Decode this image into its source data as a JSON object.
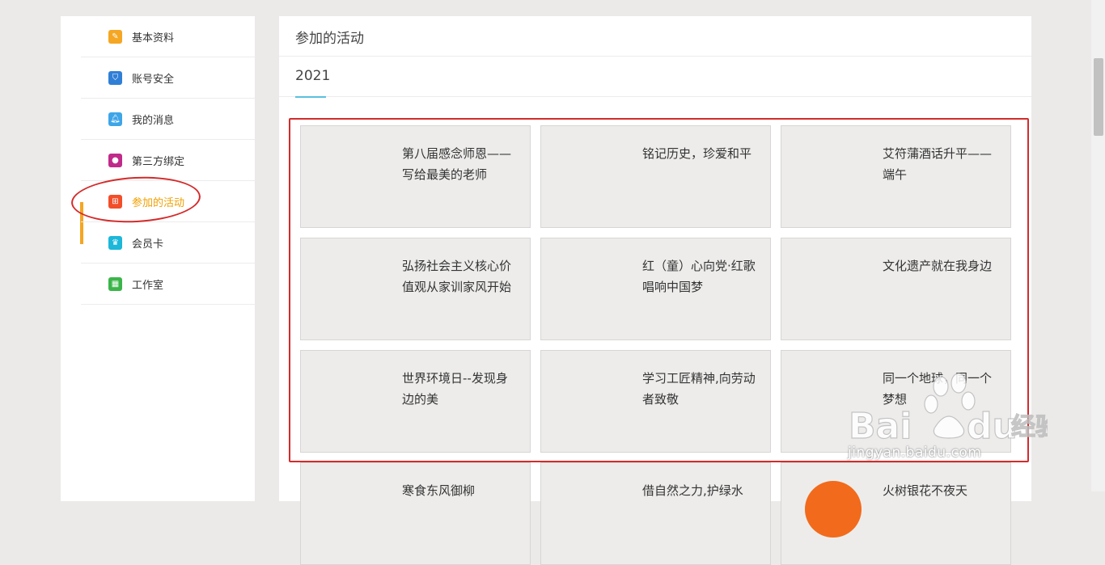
{
  "sidebar": {
    "items": [
      {
        "label": "基本资料",
        "icon": "edit-icon",
        "color": "#f5a623"
      },
      {
        "label": "账号安全",
        "icon": "shield-icon",
        "color": "#2f7fd6"
      },
      {
        "label": "我的消息",
        "icon": "bell-icon",
        "color": "#3ea5e8"
      },
      {
        "label": "第三方绑定",
        "icon": "user-icon",
        "color": "#c02a8a"
      },
      {
        "label": "参加的活动",
        "icon": "gift-icon",
        "color": "#f24e2a"
      },
      {
        "label": "会员卡",
        "icon": "crown-icon",
        "color": "#1cb7d9"
      },
      {
        "label": "工作室",
        "icon": "grid-icon",
        "color": "#3bb54a"
      }
    ],
    "active_index": 4
  },
  "main": {
    "title": "参加的活动",
    "year": "2021",
    "activities": [
      "第八届感念师恩——写给最美的老师",
      "铭记历史，珍爱和平",
      "艾符蒲酒话升平——端午",
      "弘扬社会主义核心价值观从家训家风开始",
      "红（童）心向党·红歌唱响中国梦",
      "文化遗产就在我身边",
      "世界环境日--发现身边的美",
      "学习工匠精神,向劳动者致敬",
      "同一个地球，同一个梦想",
      "寒食东风御柳",
      "借自然之力,护绿水",
      "火树银花不夜天"
    ]
  },
  "watermark": {
    "text": "Baidu经验",
    "url": "jingyan.baidu.com"
  }
}
